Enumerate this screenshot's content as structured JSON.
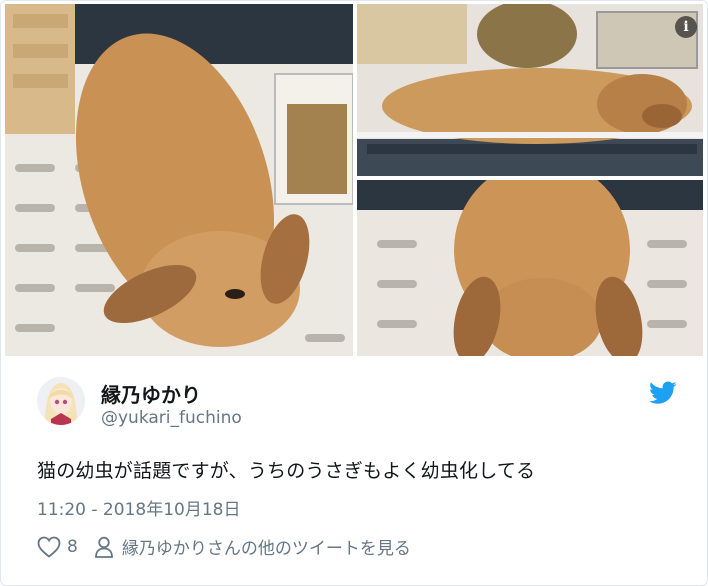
{
  "media": {
    "photos": [
      {
        "subject": "lop rabbit lying flat on cage floor"
      },
      {
        "subject": "rabbit stretched out beside food dish"
      },
      {
        "subject": "rabbit head lying low between ears"
      }
    ],
    "info_icon": "info-icon",
    "info_label": "i"
  },
  "author": {
    "display_name": "縁乃ゆかり",
    "handle": "@yukari_fuchino",
    "avatar_icon": "avatar"
  },
  "tweet": {
    "text": "猫の幼虫が話題ですが、うちのうさぎもよく幼虫化してる",
    "timestamp": "11:20 - 2018年10月18日"
  },
  "actions": {
    "like_icon": "heart-icon",
    "like_count": "8",
    "profile_icon": "person-icon",
    "more_tweets": "縁乃ゆかりさんの他のツイートを見る"
  },
  "brand": {
    "twitter_blue": "#1da1f2",
    "text_color": "#14171a",
    "muted_color": "#657786"
  }
}
